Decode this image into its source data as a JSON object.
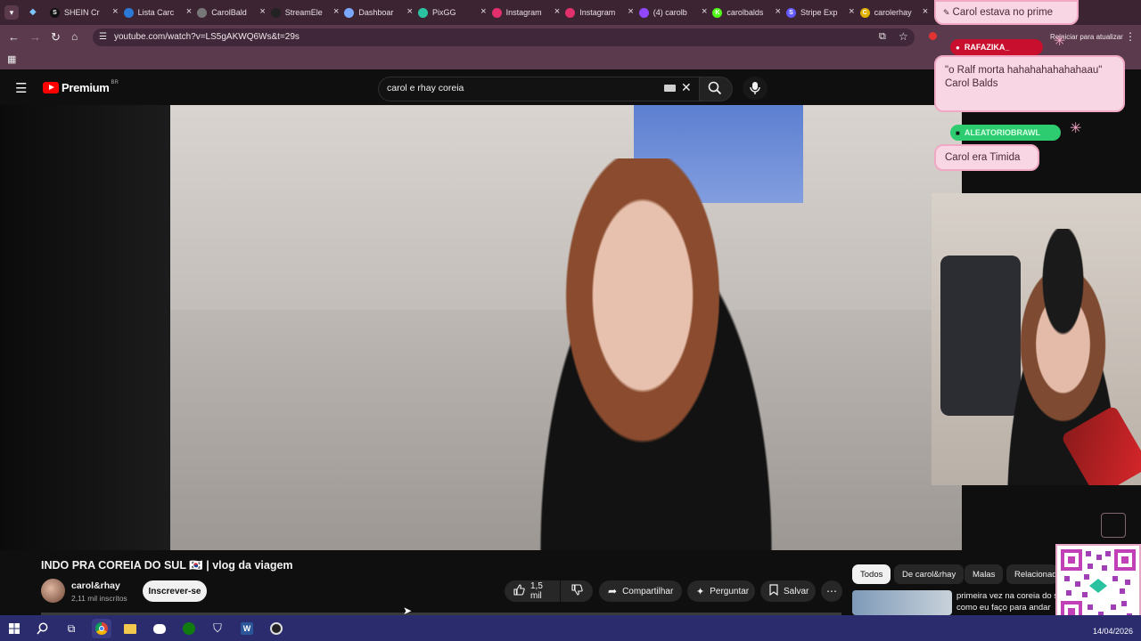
{
  "browser": {
    "tabs": [
      {
        "label": "SHEIN Cr",
        "favicon": "S",
        "color": "#111111"
      },
      {
        "label": "Lista Carc",
        "favicon": "cloud",
        "color": "#2b79d6"
      },
      {
        "label": "CarolBald",
        "favicon": "globe",
        "color": "#777777"
      },
      {
        "label": "StreamEle",
        "favicon": "anchor",
        "color": "#222222"
      },
      {
        "label": "Dashboar",
        "favicon": "circle",
        "color": "#7aa8ff"
      },
      {
        "label": "PixGG",
        "favicon": "pix",
        "color": "#2bc2a2"
      },
      {
        "label": "Instagram",
        "favicon": "ig",
        "color": "#e1306c"
      },
      {
        "label": "Instagram",
        "favicon": "ig",
        "color": "#e1306c"
      },
      {
        "label": "(4) carolb",
        "favicon": "twitch",
        "color": "#9146ff"
      },
      {
        "label": "carolbalds",
        "favicon": "K",
        "color": "#53fc18"
      },
      {
        "label": "Stripe Exp",
        "favicon": "S",
        "color": "#635bff"
      },
      {
        "label": "carolerhay",
        "favicon": "C",
        "color": "#e1b100"
      }
    ],
    "url": "youtube.com/watch?v=LS5gAKWQ6Ws&t=29s",
    "relaunch_label": "Reiniciar para atualizar"
  },
  "youtube": {
    "logo_text": "Premium",
    "region": "BR",
    "search_value": "carol e rhay coreia",
    "video_title": "INDO PRA COREIA DO SUL 🇰🇷 | vlog da viagem",
    "channel_name": "carol&rhay",
    "subscribers": "2,11 mil inscritos",
    "subscribe_label": "Inscrever-se",
    "likes": "1,5 mil",
    "share_label": "Compartilhar",
    "ask_label": "Perguntar",
    "save_label": "Salvar",
    "chips": [
      "Todos",
      "De carol&rhay",
      "Malas",
      "Relacionad"
    ],
    "related_title": "primeira vez na coreia do s como eu faço para andar"
  },
  "chat": {
    "top_message": "Carol estava no prime",
    "msg1_user": "RAFAZIKA_",
    "msg1_text": "\"o Ralf morta hahahahahahahaau\" Carol Balds",
    "msg2_user": "ALEATORIOBRAWL",
    "msg2_text": "Carol era Timida"
  },
  "taskbar": {
    "date": "14/04/2026"
  }
}
